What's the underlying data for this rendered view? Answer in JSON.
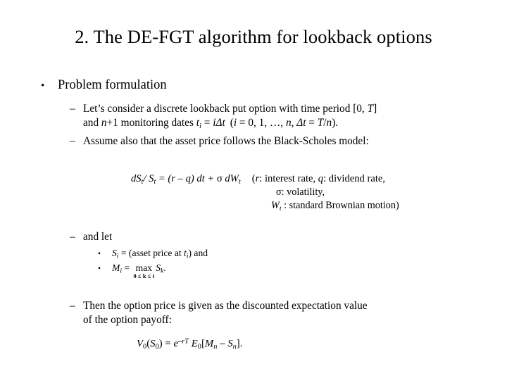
{
  "slide": {
    "title": "2. The DE-FGT algorithm for lookback options",
    "bullet_marker": "•",
    "dash_marker": "–",
    "level1": {
      "label": "Problem formulation"
    },
    "items": [
      {
        "id": "d1",
        "line1_a": "Let’s consider a discrete lookback put option with time period ",
        "line1_bracket_open": "[0, ",
        "line1_T": "T",
        "line1_bracket_close": "]",
        "line2_a": "and ",
        "line2_n": "n",
        "line2_b": "+1 monitoring dates ",
        "line2_t": "t",
        "line2_t_sub": "i",
        "line2_c": " = ",
        "line2_i": "i",
        "line2_delta": "Δ",
        "line2_dt": "t",
        "line2_paren": "(",
        "line2_i2": "i",
        "line2_d": " = 0, 1, …, ",
        "line2_n2": "n",
        "line2_e": ",  ",
        "line2_delta2": "Δ",
        "line2_t2": "t",
        "line2_f": " = ",
        "line2_T": "T",
        "line2_slash": "/",
        "line2_n3": "n",
        "line2_close": ")."
      },
      {
        "id": "d2",
        "text": "Assume also that the asset price follows the Black-Scholes model:"
      },
      {
        "id": "d3",
        "text": "and let"
      },
      {
        "id": "d4",
        "line1": "Then the option price is given as the discounted expectation value",
        "line2": "of the option payoff:"
      }
    ],
    "subbullets": [
      {
        "id": "s1",
        "S": "S",
        "S_sub": "i",
        "eq": " = (asset price at ",
        "t": "t",
        "t_sub": "i",
        "tail": ") and"
      },
      {
        "id": "s2",
        "M": "M",
        "M_sub": "i",
        "eq": " = ",
        "op": "max",
        "limits": "0 ≤ k ≤ i",
        "S": "S",
        "S_sub": "k",
        "tail": "."
      }
    ],
    "equations": {
      "sde": {
        "d1": "d",
        "S1": "S",
        "S1_sub": "t",
        "slash": "/ ",
        "S2": "S",
        "S2_sub": "t",
        "eq": " = (",
        "r": "r",
        "minus": " – ",
        "q": "q",
        "close": ") ",
        "d2": "dt",
        "plus": " + ",
        "sigma": "σ",
        "d3": " dW",
        "W_sub": "t",
        "annotation1_open": "(",
        "annotation1_r": "r",
        "annotation1_a": ": interest rate,  ",
        "annotation1_q": "q",
        "annotation1_b": ": dividend rate,"
      },
      "annotation2": {
        "sigma": "σ",
        "text": ": volatility,"
      },
      "annotation3": {
        "W": "W",
        "W_sub": "t",
        "text": " : standard Brownian motion)"
      },
      "price": {
        "V": "V",
        "V_sub": "0",
        "open": "(",
        "S": "S",
        "S_sub": "0",
        "close": ")",
        "eq": " = ",
        "e": "e",
        "e_sup": "–rT",
        "E": " E",
        "E_sub": "0",
        "bracket_open": "[",
        "M": "M",
        "M_sub": "n",
        "minus": " – ",
        "S2": "S",
        "S2_sub": "n",
        "bracket_close": "]."
      }
    }
  },
  "colors": {
    "background": "#ffffff",
    "text": "#000000"
  }
}
